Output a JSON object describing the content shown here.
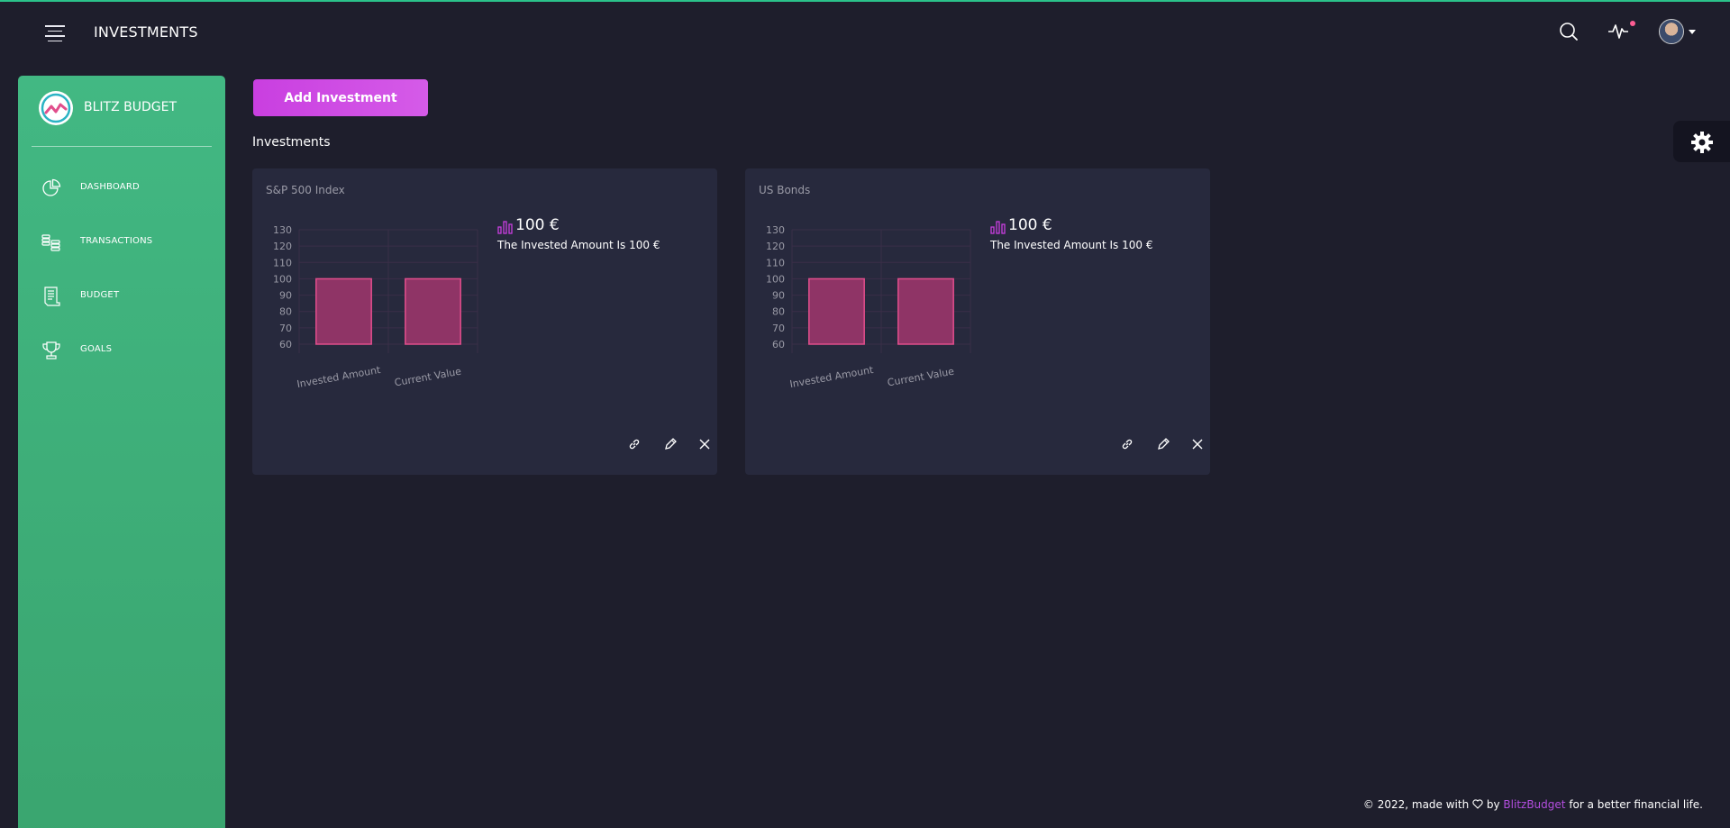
{
  "header": {
    "title": "INVESTMENTS",
    "menu_icon": "hamburger-icon",
    "search_icon": "search-icon",
    "activity_icon": "pulse-icon",
    "avatar_icon": "user-avatar"
  },
  "sidebar": {
    "brand": "BLITZ BUDGET",
    "items": [
      {
        "label": "DASHBOARD",
        "icon": "pie-chart-icon"
      },
      {
        "label": "TRANSACTIONS",
        "icon": "coins-icon"
      },
      {
        "label": "BUDGET",
        "icon": "receipt-icon"
      },
      {
        "label": "GOALS",
        "icon": "trophy-icon"
      }
    ]
  },
  "main": {
    "add_button": "Add Investment",
    "section_title": "Investments",
    "cards": [
      {
        "title": "S&P 500 Index",
        "value": "100 €",
        "description": "The Invested Amount Is 100 €"
      },
      {
        "title": "US Bonds",
        "value": "100 €",
        "description": "The Invested Amount Is 100 €"
      }
    ]
  },
  "chart_data": [
    {
      "type": "bar",
      "categories": [
        "Invested Amount",
        "Current Value"
      ],
      "values": [
        100,
        100
      ],
      "ylim": [
        60,
        130
      ],
      "yticks": [
        60,
        70,
        80,
        90,
        100,
        110,
        120,
        130
      ],
      "grid": true,
      "color": "#e14e8c"
    },
    {
      "type": "bar",
      "categories": [
        "Invested Amount",
        "Current Value"
      ],
      "values": [
        100,
        100
      ],
      "ylim": [
        60,
        130
      ],
      "yticks": [
        60,
        70,
        80,
        90,
        100,
        110,
        120,
        130
      ],
      "grid": true,
      "color": "#e14e8c"
    }
  ],
  "footer": {
    "prefix": "© 2022, made with",
    "by": "by",
    "brand": "BlitzBudget",
    "suffix": "for a better financial life."
  },
  "colors": {
    "accent_green": "#42b883",
    "accent_purple": "#c93fe0",
    "bar_pink": "#e14e8c",
    "background": "#1e1e2c",
    "card": "#27293d"
  }
}
